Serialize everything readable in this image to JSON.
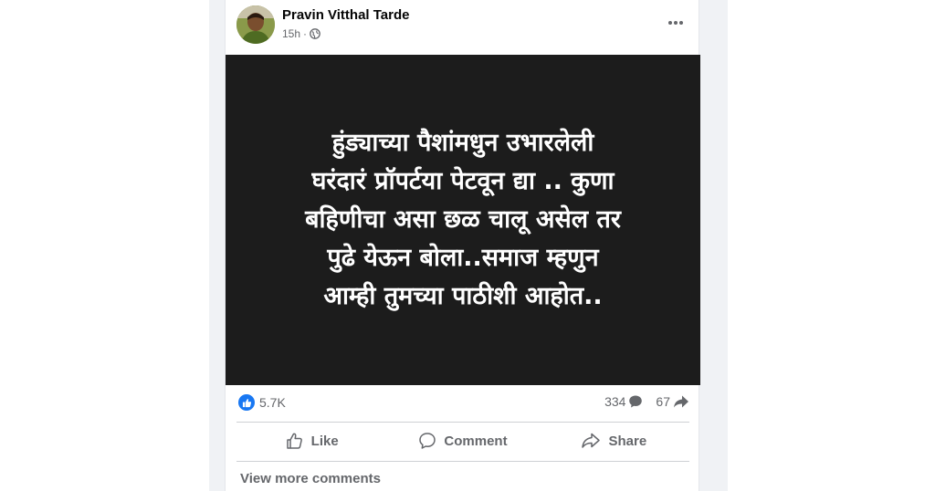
{
  "post": {
    "author": "Pravin Vitthal Tarde",
    "time": "15h",
    "separator": "·",
    "privacy_icon": "globe-icon",
    "menu_icon": "ellipsis-icon",
    "image_text": "हुंड्याच्या पैशांमधुन उभारलेली\nघरंदारं प्रॉपर्टया पेटवून द्या .. कुणा\nबहिणीचा असा छळ चालू असेल तर\nपुढे येऊन बोला..समाज म्हणुन\nआम्ही तुमच्या पाठीशी आहोत..",
    "image_background": "#1c1c1c"
  },
  "stats": {
    "reactions": "5.7K",
    "comments": "334",
    "shares": "67"
  },
  "actions": {
    "like": "Like",
    "comment": "Comment",
    "share": "Share"
  },
  "comments": {
    "view_more": "View more comments"
  },
  "colors": {
    "brand": "#1877f2",
    "secondary_text": "#65676b",
    "divider": "#ced0d4"
  }
}
